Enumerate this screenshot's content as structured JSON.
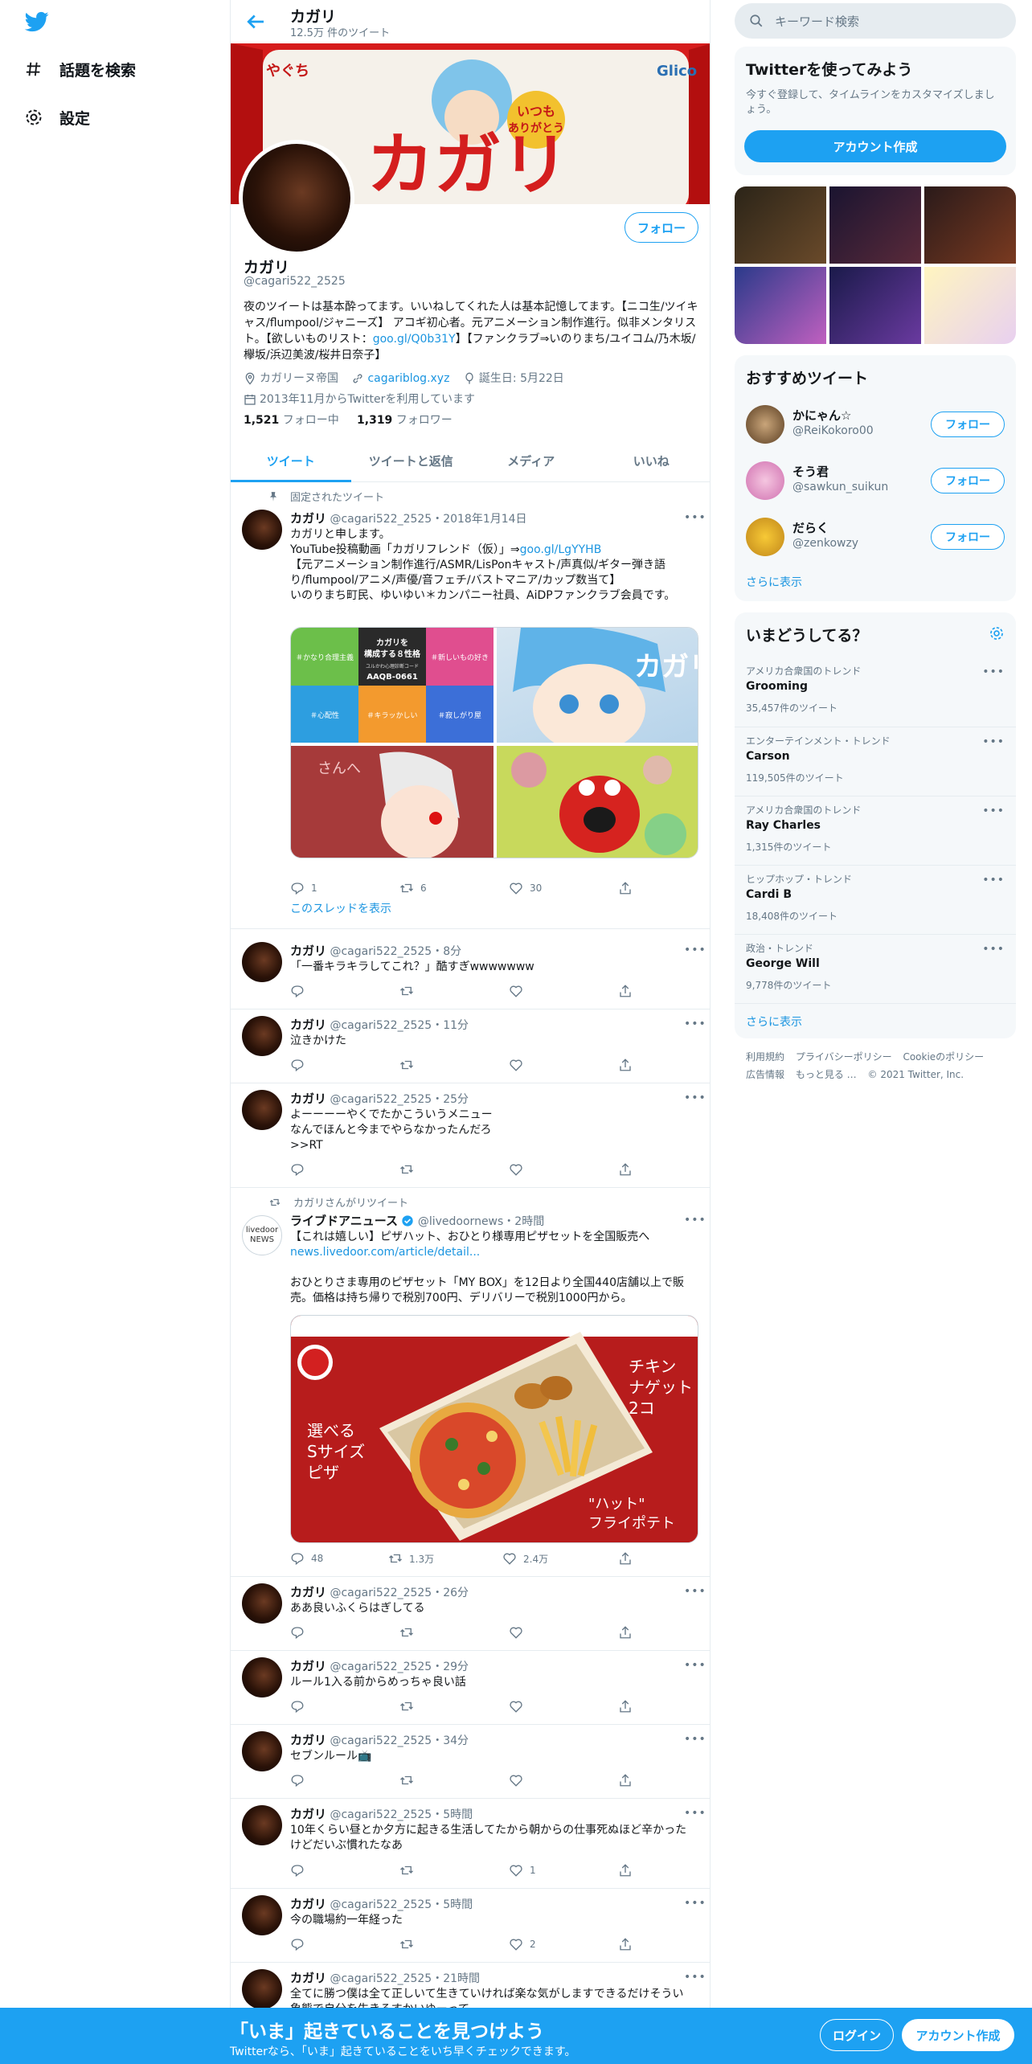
{
  "nav": {
    "explore": "話題を検索",
    "settings": "設定"
  },
  "profile": {
    "name": "カガリ",
    "tweet_count": "12.5万 件のツイート",
    "handle": "@cagari522_2525",
    "follow": "フォロー",
    "bio": "夜のツイートは基本酔ってます。いいねしてくれた人は基本記憶してます。【ニコ生/ツイキャス/flumpool/ジャニーズ】 アコギ初心者。元アニメーション制作進行。似非メンタリスト。【欲しいものリスト：",
    "bio_link": "goo.gl/Q0b31Y",
    "bio_end": "】【ファンクラブ⇒いのりまち/ユイコム/乃木坂/欅坂/浜辺美波/桜井日奈子】",
    "location": "カガリーヌ帝国",
    "website": "cagariblog.xyz",
    "birthday": "誕生日: 5月22日",
    "joined": "2013年11月からTwitterを利用しています",
    "following_count": "1,521",
    "following_label": "フォロー中",
    "followers_count": "1,319",
    "followers_label": "フォロワー",
    "banner_text": "カガリ",
    "banner_badge": "いつも ありがとう",
    "banner_brand": "Glico",
    "banner_corner": "やぐち"
  },
  "tabs": [
    "ツイート",
    "ツイートと返信",
    "メディア",
    "いいね"
  ],
  "pinned": {
    "label": "固定されたツイート",
    "name": "カガリ",
    "meta": "@cagari522_2525・2018年1月14日",
    "line1": "カガリと申します。",
    "line2a": "YouTube投稿動画「カガリフレンド（仮）」⇒",
    "line2_link": "goo.gl/LgYYHB",
    "line3": "【元アニメーション制作進行/ASMR/LisPonキャスト/声真似/ギター弾き語り/flumpool/アニメ/声優/音フェチ/バストマニア/カップ数当て】",
    "line4": "いのりまち町民、ゆいゆい＊カンパニー社員、AiDPファンクラブ会員です。",
    "img1": {
      "c1": "＃かなり合理主義",
      "c2": "カガリを\n構成する８性格",
      "c2sub": "ユルかわ心理診断コード",
      "c2code": "AAQB-0661",
      "c3": "＃新しいもの好き",
      "c4": "＃心配性",
      "c5": "＃キラッかしい",
      "c6": "＃寂しがり屋"
    },
    "img2_text": "カガリ",
    "img3_text": "さんへ",
    "replies": "1",
    "retweets": "6",
    "likes": "30",
    "thread": "このスレッドを表示"
  },
  "tweets": [
    {
      "name": "カガリ",
      "meta": "@cagari522_2525・8分",
      "text": "「一番キラキラしてこれ？」酷すぎwwwwwww",
      "likes": ""
    },
    {
      "name": "カガリ",
      "meta": "@cagari522_2525・11分",
      "text": "泣きかけた",
      "likes": ""
    },
    {
      "name": "カガリ",
      "meta": "@cagari522_2525・25分",
      "text": "よーーーーやくでたかこういうメニュー\nなんでほんと今までやらなかったんだろ\n>>RT",
      "likes": ""
    }
  ],
  "retweet": {
    "label": "カガリさんがリツイート",
    "avatar_text": "livedoor NEWS",
    "name": "ライブドアニュース",
    "meta": "@livedoornews・2時間",
    "line1": "【これは嬉しい】ピザハット、おひとり様専用ピザセットを全国販売へ",
    "link": "news.livedoor.com/article/detail...",
    "line2": "おひとりさま専用のピザセット「MY BOX」を12日より全国440店舗以上で販売。価格は持ち帰りで税別700円、デリバリーで税別1000円から。",
    "img_left": "選べる\nSサイズ\nピザ",
    "img_right1": "チキン\nナゲット\n2コ",
    "img_right2": "\"ハット\"\nフライポテト",
    "replies": "48",
    "retweets": "1.3万",
    "likes": "2.4万"
  },
  "tweets2": [
    {
      "name": "カガリ",
      "meta": "@cagari522_2525・26分",
      "text": "ああ良いふくらはぎしてる",
      "likes": ""
    },
    {
      "name": "カガリ",
      "meta": "@cagari522_2525・29分",
      "text": "ルール1入る前からめっちゃ良い話",
      "likes": ""
    },
    {
      "name": "カガリ",
      "meta": "@cagari522_2525・34分",
      "text": "セブンルール📺",
      "likes": ""
    },
    {
      "name": "カガリ",
      "meta": "@cagari522_2525・5時間",
      "text": "10年くらい昼とか夕方に起きる生活してたから朝からの仕事死ぬほど辛かったけどだいぶ慣れたなあ",
      "likes": "1"
    },
    {
      "name": "カガリ",
      "meta": "@cagari522_2525・5時間",
      "text": "今の職場約一年経った",
      "likes": "2"
    },
    {
      "name": "カガリ",
      "meta": "@cagari522_2525・21時間",
      "text": "全てに勝つ僕は全て正しいて生きていければ楽な気がしますできるだけそうい象態で自分を生きるすかいゆーって",
      "likes": ""
    }
  ],
  "right": {
    "search_placeholder": "キーワード検索",
    "signup_title": "Twitterを使ってみよう",
    "signup_desc": "今すぐ登録して、タイムラインをカスタマイズしましょう。",
    "signup_btn": "アカウント作成",
    "rec_title": "おすすめツイート",
    "recs": [
      {
        "name": "かにゃん☆",
        "handle": "@ReiKokoro00",
        "btn": "フォロー"
      },
      {
        "name": "そう君",
        "handle": "@sawkun_suikun",
        "btn": "フォロー"
      },
      {
        "name": "だらく",
        "handle": "@zenkowzy",
        "btn": "フォロー"
      }
    ],
    "more": "さらに表示",
    "trends_title": "いまどうしてる？",
    "trends": [
      {
        "cat": "アメリカ合衆国のトレンド",
        "name": "Grooming",
        "count": "35,457件のツイート"
      },
      {
        "cat": "エンターテインメント・トレンド",
        "name": "Carson",
        "count": "119,505件のツイート"
      },
      {
        "cat": "アメリカ合衆国のトレンド",
        "name": "Ray Charles",
        "count": "1,315件のツイート"
      },
      {
        "cat": "ヒップホップ・トレンド",
        "name": "Cardi B",
        "count": "18,408件のツイート"
      },
      {
        "cat": "政治・トレンド",
        "name": "George Will",
        "count": "9,778件のツイート"
      }
    ],
    "trends_more": "さらに表示",
    "footer": [
      "利用規約",
      "プライバシーポリシー",
      "Cookieのポリシー",
      "広告情報",
      "もっと見る …",
      "© 2021 Twitter, Inc."
    ]
  },
  "bottom": {
    "title": "「いま」起きていることを見つけよう",
    "sub": "Twitterなら、「いま」起きていることをいち早くチェックできます。",
    "login": "ログイン",
    "signup": "アカウント作成"
  }
}
